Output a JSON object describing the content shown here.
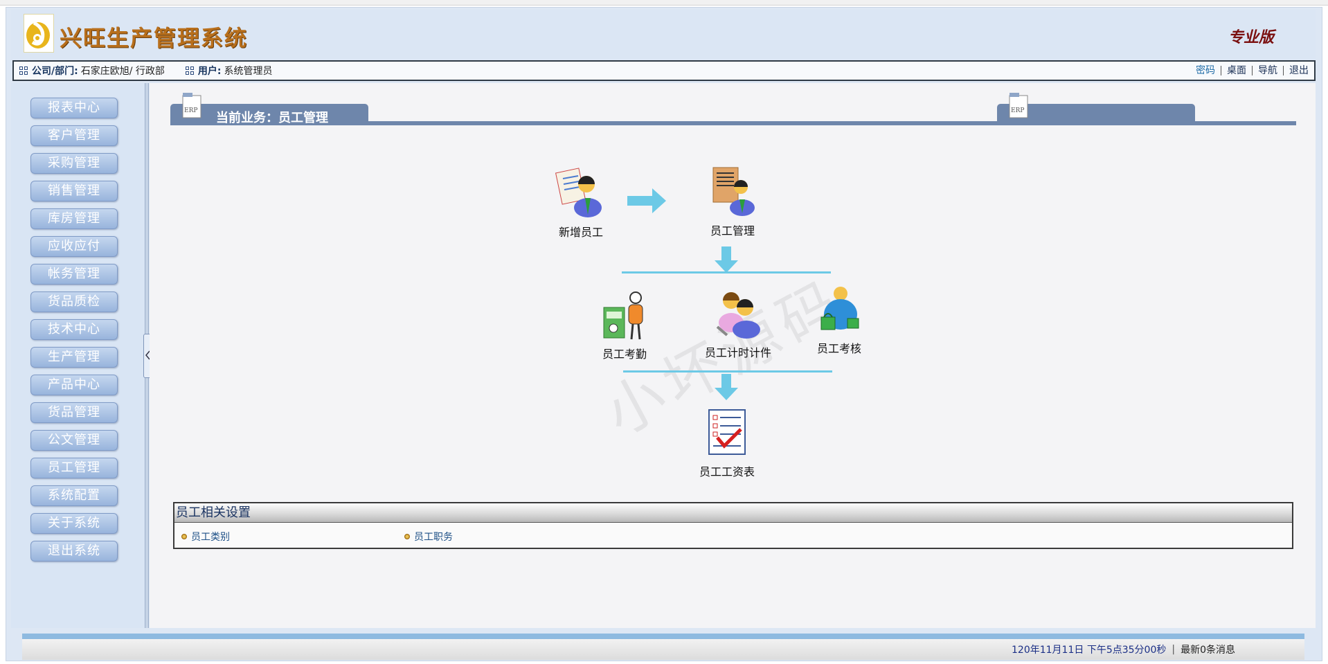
{
  "header": {
    "app_title": "兴旺生产管理系统",
    "edition": "专业版"
  },
  "infobar": {
    "company_label": "公司/部门:",
    "company_value": "石家庄欧旭/ 行政部",
    "user_label": "用户:",
    "user_value": "系统管理员",
    "links": [
      "密码",
      "桌面",
      "导航",
      "退出"
    ]
  },
  "sidebar": {
    "items": [
      "报表中心",
      "客户管理",
      "采购管理",
      "销售管理",
      "库房管理",
      "应收应付",
      "帐务管理",
      "货品质检",
      "技术中心",
      "生产管理",
      "产品中心",
      "货品管理",
      "公文管理",
      "员工管理",
      "系统配置",
      "关于系统",
      "退出系统"
    ]
  },
  "main": {
    "tab_title": "当前业务：员工管理",
    "watermark": "小坏源码",
    "flow": {
      "add_employee": "新增员工",
      "employee_mgmt": "员工管理",
      "attendance": "员工考勤",
      "timesheet": "员工计时计件",
      "assessment": "员工考核",
      "payroll": "员工工资表"
    },
    "settings": {
      "title": "员工相关设置",
      "links": [
        "员工类别",
        "员工职务"
      ]
    }
  },
  "footer": {
    "time": "120年11月11日 下午5点35分00秒",
    "messages": "最新0条消息"
  },
  "colors": {
    "header_bg": "#dbe6f4",
    "tab_blue": "#6e86ab",
    "arrow_cyan": "#6cc9e6",
    "sidebar_btn": "#a8c0e3"
  }
}
